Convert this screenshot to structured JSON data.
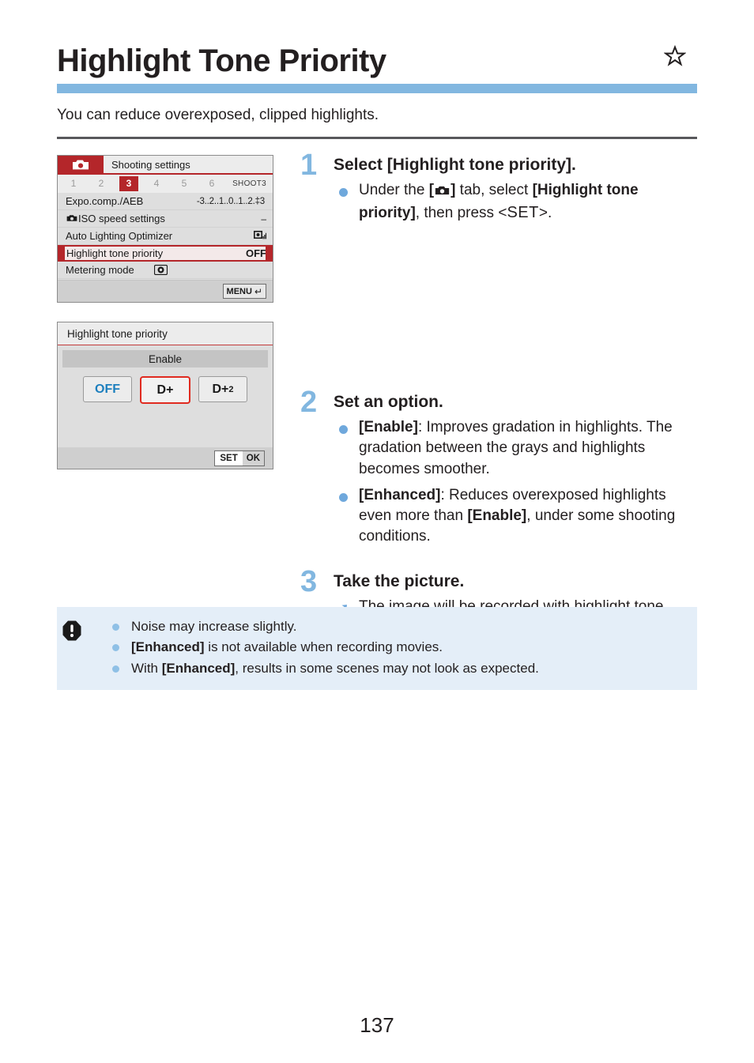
{
  "header": {
    "title": "Highlight Tone Priority",
    "star_icon": "star-outline-icon",
    "intro": "You can reduce overexposed, clipped highlights.",
    "accent_color": "#82b7e0"
  },
  "camera_screen_1": {
    "icon": "camera-icon",
    "title": "Shooting settings",
    "tabs": [
      "1",
      "2",
      "3",
      "4",
      "5",
      "6"
    ],
    "active_tab": "3",
    "tab_tag": "SHOOT3",
    "rows": [
      {
        "label": "Expo.comp./AEB",
        "value": "-3..2..1..0..1..2.‡3",
        "icon": "",
        "selected": false
      },
      {
        "label": "ISO speed settings",
        "value": "–",
        "icon": "camera-icon",
        "selected": false
      },
      {
        "label": "Auto Lighting Optimizer",
        "value": "",
        "icon_value": "alo-icon",
        "selected": false
      },
      {
        "label": "Highlight tone priority",
        "value": "OFF",
        "icon": "",
        "selected": true
      },
      {
        "label": "Metering mode",
        "value": "",
        "icon_value": "metering-icon",
        "selected": false
      }
    ],
    "menu_button": "MENU",
    "menu_return_icon": "return-arrow-icon"
  },
  "camera_screen_2": {
    "title": "Highlight tone priority",
    "subtitle": "Enable",
    "options": [
      {
        "label": "OFF",
        "sub": "",
        "selected": false,
        "color": "#1c7fbe"
      },
      {
        "label": "D+",
        "sub": "",
        "selected": true,
        "color": "#1a1a1a"
      },
      {
        "label": "D+",
        "sub": "2",
        "selected": false,
        "color": "#1a1a1a"
      }
    ],
    "set_label": "SET",
    "ok_label": "OK"
  },
  "steps": [
    {
      "number": "1",
      "heading": "Select [Highlight tone priority].",
      "bullets": [
        {
          "marker": "dot",
          "parts": [
            {
              "t": "Under the ",
              "b": false
            },
            {
              "t": "[",
              "b": true
            },
            {
              "t": "camera-icon",
              "b": true,
              "icon": true
            },
            {
              "t": "]",
              "b": true
            },
            {
              "t": " tab, select ",
              "b": false
            },
            {
              "t": "[Highlight tone priority]",
              "b": true
            },
            {
              "t": ", then press <",
              "b": false
            },
            {
              "t": "SET",
              "b": false,
              "set": true
            },
            {
              "t": ">.",
              "b": false
            }
          ]
        }
      ]
    },
    {
      "number": "2",
      "heading": "Set an option.",
      "bullets": [
        {
          "marker": "dot",
          "parts": [
            {
              "t": "[Enable]",
              "b": true
            },
            {
              "t": ": Improves gradation in highlights. The gradation between the grays and highlights becomes smoother.",
              "b": false
            }
          ]
        },
        {
          "marker": "dot",
          "parts": [
            {
              "t": "[Enhanced]",
              "b": true
            },
            {
              "t": ": Reduces overexposed highlights even more than ",
              "b": false
            },
            {
              "t": "[Enable]",
              "b": true
            },
            {
              "t": ", under some shooting conditions.",
              "b": false
            }
          ]
        }
      ]
    },
    {
      "number": "3",
      "heading": "Take the picture.",
      "bullets": [
        {
          "marker": "arrow",
          "parts": [
            {
              "t": "The image will be recorded with highlight tone priority applied.",
              "b": false
            }
          ]
        }
      ]
    }
  ],
  "caution": {
    "icon": "caution-octagon-icon",
    "items": [
      [
        {
          "t": "Noise may increase slightly.",
          "b": false
        }
      ],
      [
        {
          "t": "[Enhanced]",
          "b": true
        },
        {
          "t": " is not available when recording movies.",
          "b": false
        }
      ],
      [
        {
          "t": "With ",
          "b": false
        },
        {
          "t": "[Enhanced]",
          "b": true
        },
        {
          "t": ", results in some scenes may not look as expected.",
          "b": false
        }
      ]
    ]
  },
  "footer": {
    "page_number": "137"
  }
}
